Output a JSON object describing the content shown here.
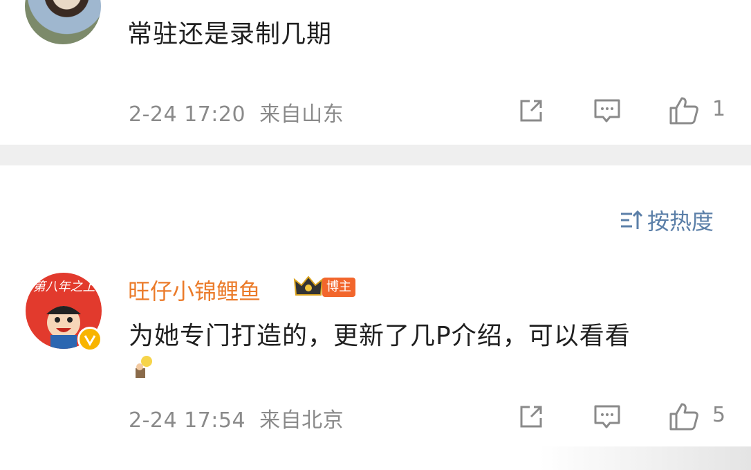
{
  "comments": [
    {
      "text": "常驻还是录制几期",
      "time": "2-24 17:20",
      "location": "来自山东",
      "likes": "1",
      "avatar_icon": "user-avatar-photo"
    },
    {
      "username": "旺仔小锦鲤鱼",
      "badge": "博主",
      "text_line1": "为她专门打造的，更新了几P介绍，可以看看",
      "time": "2-24 17:54",
      "location": "来自北京",
      "likes": "5",
      "avatar_text": "第八年之上",
      "avatar_icon": "wangzai-logo-avatar",
      "emoji_icon": "lightbulb-person-emoji"
    }
  ],
  "sort": {
    "label": "按热度",
    "icon": "sort-icon"
  },
  "colors": {
    "username": "#eb7b2a",
    "sort_link": "#5b7fa8",
    "meta_text": "#8a8a8a",
    "divider": "#efefef",
    "badge_bg": "#f2662c"
  }
}
